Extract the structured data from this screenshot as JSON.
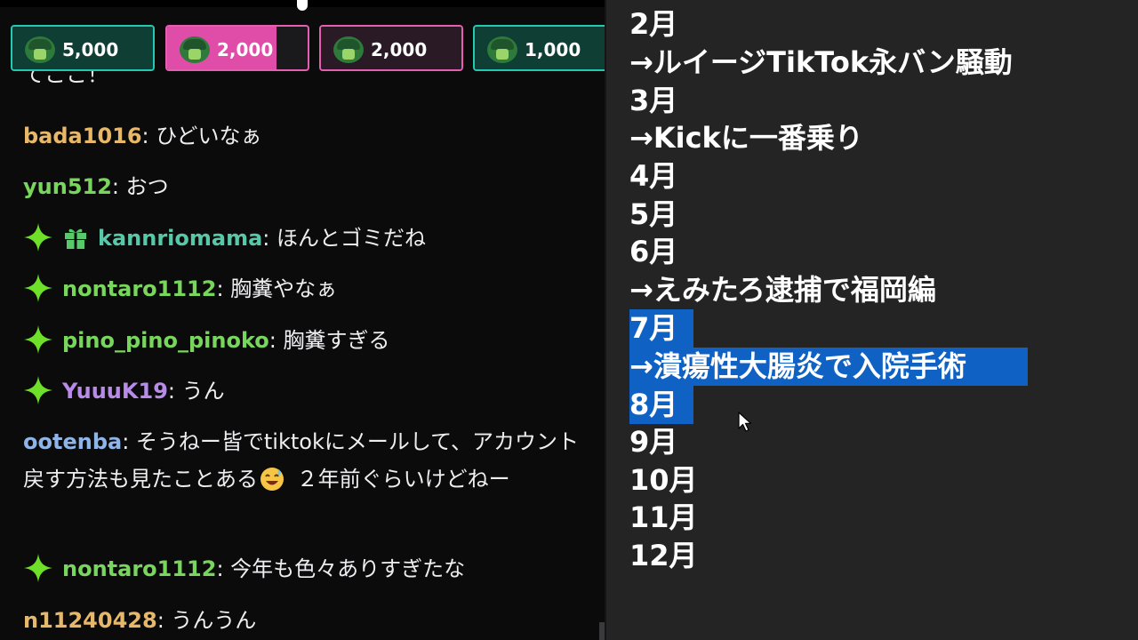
{
  "leaderboard": [
    {
      "amount": "5,000",
      "border": "#23c9b0",
      "fill": "#0f3e35",
      "fill_fraction": 1.0
    },
    {
      "amount": "2,000",
      "border": "#e35fb0",
      "fill": "#e04da8",
      "fill_fraction": 0.78
    },
    {
      "amount": "2,000",
      "border": "#e35fb0",
      "fill": "#2a1a26",
      "fill_fraction": 1.0
    },
    {
      "amount": "1,000",
      "border": "#23c9b0",
      "fill": "#0f3e35",
      "fill_fraction": 1.0
    }
  ],
  "chat": {
    "cut_line": "てここ！",
    "messages": [
      {
        "user": "bada1016",
        "user_color": "#e8b86a",
        "text": ": ひどいなぁ",
        "spark": false,
        "gift": false
      },
      {
        "user": "yun512",
        "user_color": "#79d65c",
        "text": ": おつ",
        "spark": false,
        "gift": false
      },
      {
        "user": "kannriomama",
        "user_color": "#57c9a8",
        "text": ": ほんとゴミだね",
        "spark": true,
        "gift": true
      },
      {
        "user": "nontaro1112",
        "user_color": "#79d65c",
        "text": ": 胸糞やなぁ",
        "spark": true,
        "gift": false
      },
      {
        "user": "pino_pino_pinoko",
        "user_color": "#79d65c",
        "text": ": 胸糞すぎる",
        "spark": true,
        "gift": false
      },
      {
        "user": "YuuuK19",
        "user_color": "#b98be8",
        "text": ": うん",
        "spark": true,
        "gift": false
      },
      {
        "user": "ootenba",
        "user_color": "#8fb4e8",
        "text_a": ": そうねー皆でtiktokにメールして、アカウント戻す方法も見たことある",
        "text_b": " ２年前ぐらいけどねー",
        "spark": false,
        "gift": false
      },
      {
        "user": "nontaro1112",
        "user_color": "#79d65c",
        "text": ": 今年も色々ありすぎたな",
        "spark": true,
        "gift": false
      },
      {
        "user": "n11240428",
        "user_color": "#e8b86a",
        "text": ": うんうん",
        "spark": false,
        "gift": false
      }
    ]
  },
  "notepad": {
    "lines": [
      "2月",
      "→ルイージTikTok永バン騒動",
      "3月",
      "→Kickに一番乗り",
      "4月",
      "5月",
      "6月",
      "→えみたろ逮捕で福岡編",
      "7月",
      "→潰瘍性大腸炎で入院手術",
      "8月",
      "9月",
      "10月",
      "11月",
      "12月"
    ],
    "selected_lines": [
      "7月",
      "→潰瘍性大腸炎で入院手術",
      "8月"
    ]
  },
  "colors": {
    "chat_bg": "#0b0b0c",
    "notepad_bg": "#242424",
    "selection": "#0f62c4",
    "spark": "#6fe02a",
    "gift": "#57c96a"
  },
  "icons": [
    "sparkle-icon",
    "gift-icon",
    "smiling-sweat-emoji-icon",
    "mouse-cursor-icon",
    "avatar-icon"
  ]
}
